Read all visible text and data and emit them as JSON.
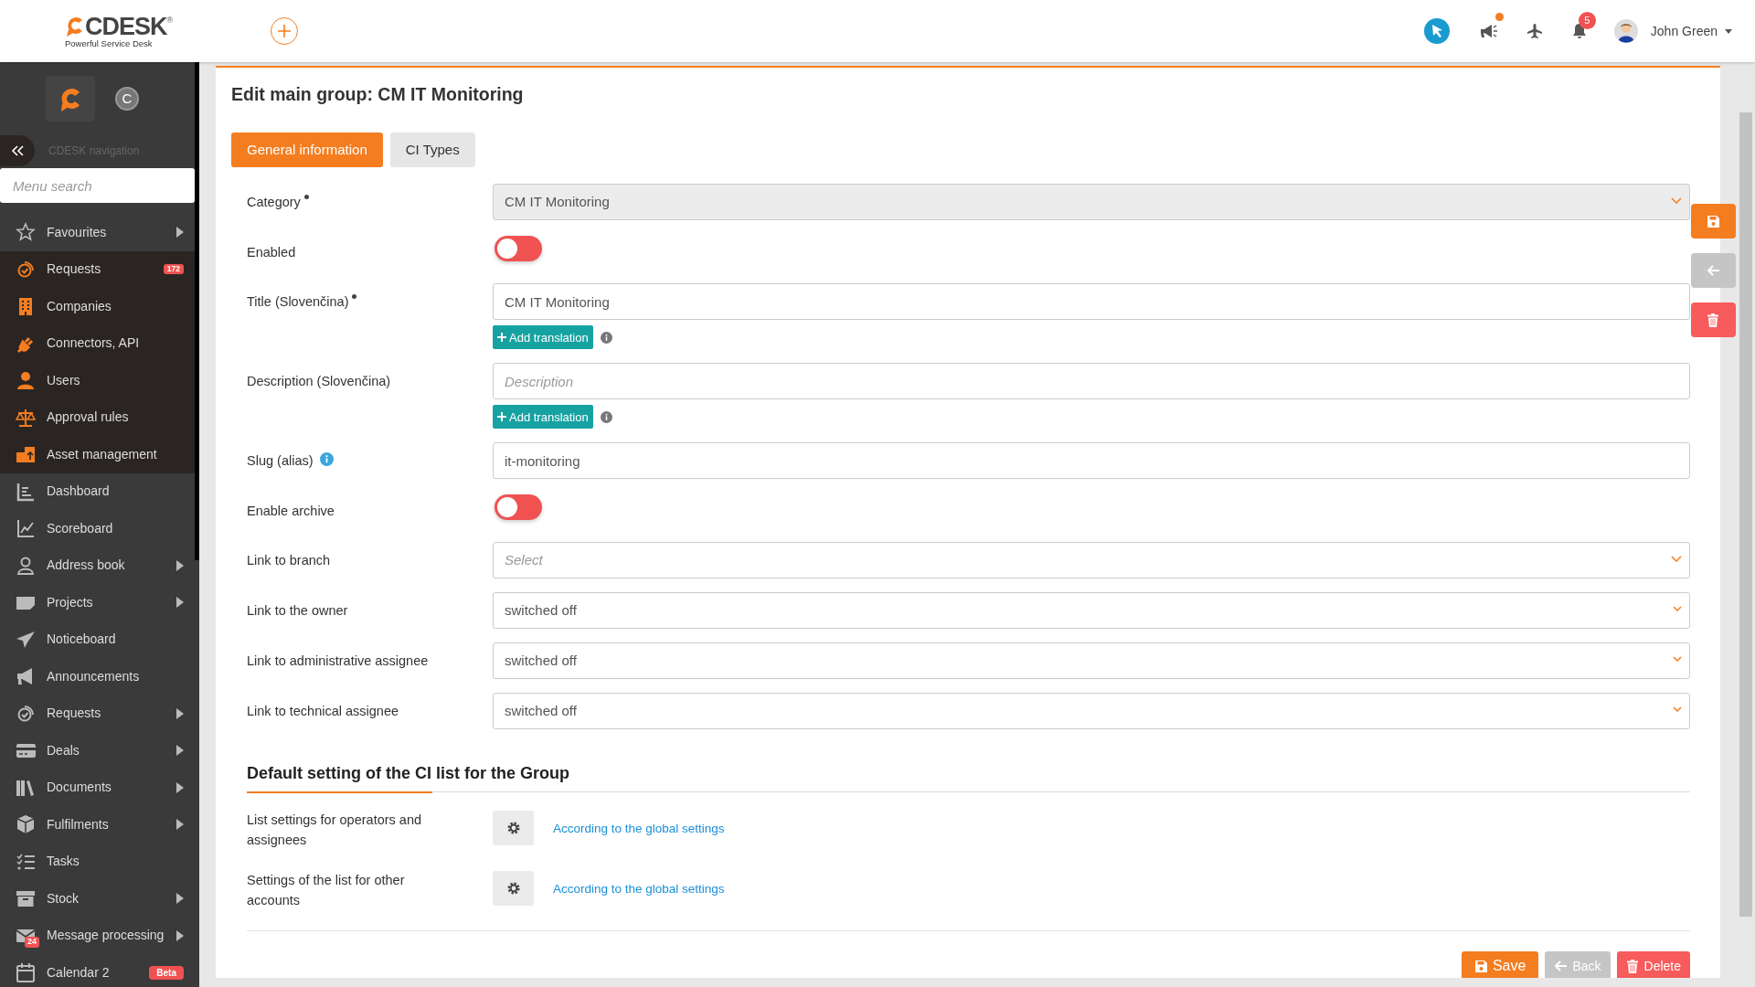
{
  "header": {
    "logo": {
      "brand": "CDESK",
      "mark": "®",
      "tagline": "Powerful Service Desk"
    },
    "announcements_unread": true,
    "notifications_badge": "5",
    "user": {
      "name": "John Green"
    }
  },
  "sidebar": {
    "avatar_letter": "C",
    "nav_title": "CDESK navigation",
    "search": {
      "placeholder": "Menu search"
    },
    "items": [
      {
        "label": "Favourites",
        "submenu": true,
        "accent": false
      },
      {
        "label": "Requests",
        "submenu": false,
        "accent": true,
        "badge": "172"
      },
      {
        "label": "Companies",
        "submenu": false,
        "accent": true
      },
      {
        "label": "Connectors, API",
        "submenu": false,
        "accent": true
      },
      {
        "label": "Users",
        "submenu": false,
        "accent": true
      },
      {
        "label": "Approval rules",
        "submenu": false,
        "accent": true
      },
      {
        "label": "Asset management",
        "submenu": false,
        "accent": true
      },
      {
        "label": "Dashboard",
        "submenu": false,
        "accent": false
      },
      {
        "label": "Scoreboard",
        "submenu": false,
        "accent": false
      },
      {
        "label": "Address book",
        "submenu": true,
        "accent": false
      },
      {
        "label": "Projects",
        "submenu": true,
        "accent": false
      },
      {
        "label": "Noticeboard",
        "submenu": false,
        "accent": false
      },
      {
        "label": "Announcements",
        "submenu": false,
        "accent": false
      },
      {
        "label": "Requests",
        "submenu": true,
        "accent": false
      },
      {
        "label": "Deals",
        "submenu": true,
        "accent": false
      },
      {
        "label": "Documents",
        "submenu": true,
        "accent": false
      },
      {
        "label": "Fulfilments",
        "submenu": true,
        "accent": false
      },
      {
        "label": "Tasks",
        "submenu": false,
        "accent": false
      },
      {
        "label": "Stock",
        "submenu": true,
        "accent": false
      },
      {
        "label": "Message processing",
        "submenu": true,
        "accent": false,
        "icon_badge": "24"
      },
      {
        "label": "Calendar 2",
        "submenu": false,
        "accent": false,
        "badge": "Beta"
      }
    ]
  },
  "page": {
    "title": "Edit main group: CM IT Monitoring",
    "tabs": [
      {
        "label": "General information",
        "selected": true
      },
      {
        "label": "CI Types",
        "selected": false
      }
    ],
    "fields": [
      {
        "kind": "select",
        "label": "Category",
        "required": true,
        "value": "CM IT Monitoring",
        "disabled": true
      },
      {
        "kind": "toggle",
        "label": "Enabled",
        "on": false
      },
      {
        "kind": "text",
        "label": "Title (Slovenčina)",
        "required": true,
        "value": "CM IT Monitoring",
        "translation_button": "Add translation"
      },
      {
        "kind": "text",
        "label": "Description (Slovenčina)",
        "placeholder": "Description",
        "translation_button": "Add translation"
      },
      {
        "kind": "text",
        "label": "Slug (alias)",
        "info": true,
        "value": "it-monitoring"
      },
      {
        "kind": "toggle",
        "label": "Enable archive",
        "on": false
      },
      {
        "kind": "select",
        "label": "Link to branch",
        "placeholder": "Select"
      },
      {
        "kind": "select",
        "label": "Link to the owner",
        "value": "switched off"
      },
      {
        "kind": "select",
        "label": "Link to administrative assignee",
        "value": "switched off"
      },
      {
        "kind": "select",
        "label": "Link to technical assignee",
        "value": "switched off"
      }
    ],
    "section": {
      "heading": "Default setting of the CI list for the Group",
      "rows": [
        {
          "label": "List settings for operators and assignees",
          "link": "According to the global settings"
        },
        {
          "label": "Settings of the list for other accounts",
          "link": "According to the global settings"
        }
      ]
    },
    "buttons": [
      {
        "kind": "save",
        "label": "Save"
      },
      {
        "kind": "back",
        "label": "Back"
      },
      {
        "kind": "delete",
        "label": "Delete"
      }
    ],
    "side_actions": [
      {
        "kind": "save"
      },
      {
        "kind": "back"
      },
      {
        "kind": "delete"
      }
    ]
  }
}
